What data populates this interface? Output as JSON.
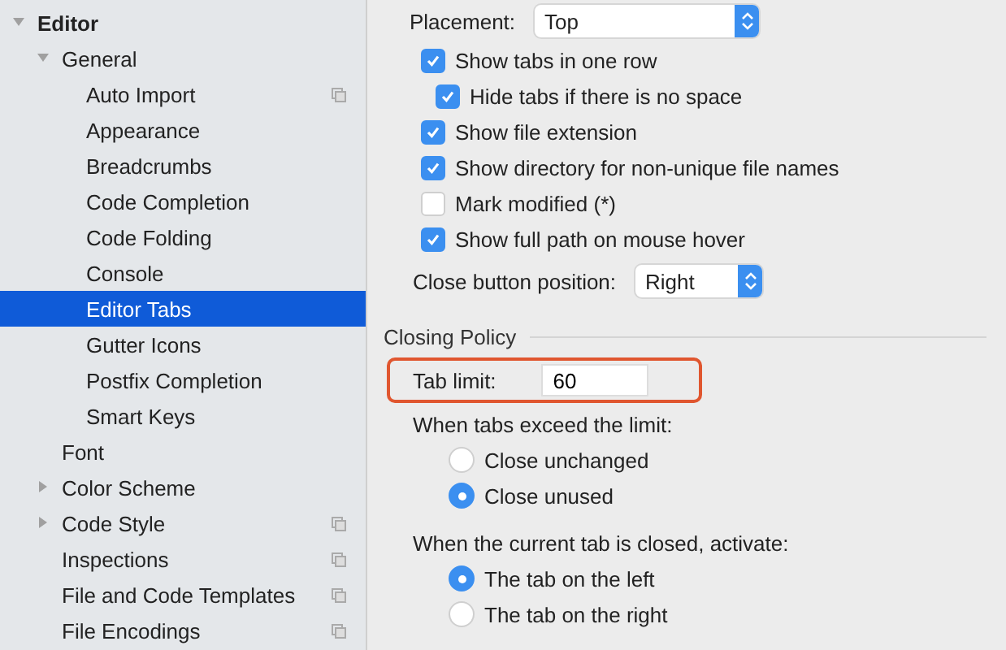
{
  "sidebar": {
    "items": [
      {
        "label": "Editor",
        "bold": true,
        "expanded": true,
        "children": [
          {
            "label": "General",
            "expanded": true,
            "children": [
              {
                "label": "Auto Import",
                "project": true,
                "selected": false
              },
              {
                "label": "Appearance",
                "selected": false
              },
              {
                "label": "Breadcrumbs",
                "selected": false
              },
              {
                "label": "Code Completion",
                "selected": false
              },
              {
                "label": "Code Folding",
                "selected": false
              },
              {
                "label": "Console",
                "selected": false
              },
              {
                "label": "Editor Tabs",
                "selected": true
              },
              {
                "label": "Gutter Icons",
                "selected": false
              },
              {
                "label": "Postfix Completion",
                "selected": false
              },
              {
                "label": "Smart Keys",
                "selected": false
              }
            ],
            "selected": false
          },
          {
            "label": "Font",
            "selected": false
          },
          {
            "label": "Color Scheme",
            "expanded": false,
            "selected": false
          },
          {
            "label": "Code Style",
            "expanded": false,
            "project": true,
            "selected": false
          },
          {
            "label": "Inspections",
            "project": true,
            "selected": false
          },
          {
            "label": "File and Code Templates",
            "project": true,
            "selected": false
          },
          {
            "label": "File Encodings",
            "project": true,
            "selected": false
          }
        ],
        "selected": false
      }
    ]
  },
  "placement": {
    "label": "Placement:",
    "value": "Top"
  },
  "options": [
    {
      "label": "Show tabs in one row",
      "checked": true,
      "children": [
        {
          "label": "Hide tabs if there is no space",
          "checked": true
        }
      ]
    },
    {
      "label": "Show file extension",
      "checked": true
    },
    {
      "label": "Show directory for non-unique file names",
      "checked": true
    },
    {
      "label": "Mark modified (*)",
      "checked": false
    },
    {
      "label": "Show full path on mouse hover",
      "checked": true
    }
  ],
  "close_button": {
    "label": "Close button position:",
    "value": "Right"
  },
  "closing_policy": {
    "title": "Closing Policy",
    "tab_limit": {
      "label": "Tab limit:",
      "value": "60",
      "highlighted": true
    },
    "groups": [
      {
        "label": "When tabs exceed the limit:",
        "options": [
          {
            "label": "Close unchanged",
            "selected": false
          },
          {
            "label": "Close unused",
            "selected": true
          }
        ]
      },
      {
        "label": "When the current tab is closed, activate:",
        "options": [
          {
            "label": "The tab on the left",
            "selected": true
          },
          {
            "label": "The tab on the right",
            "selected": false
          }
        ]
      }
    ]
  }
}
